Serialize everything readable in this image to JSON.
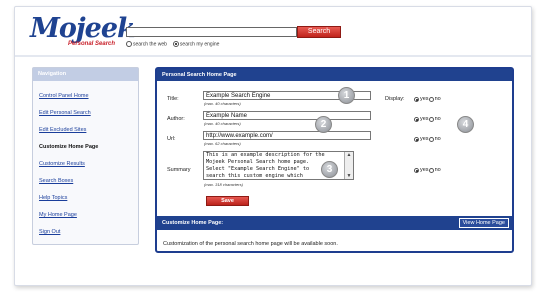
{
  "logo": {
    "text": "Mojeek",
    "subtitle": "Personal Search"
  },
  "search": {
    "value": "",
    "button_label": "Search",
    "scope_web": "search the web",
    "scope_engine": "search my engine"
  },
  "sidebar": {
    "title": "Navigation",
    "items": [
      {
        "label": "Control Panel Home"
      },
      {
        "label": "Edit Personal Search"
      },
      {
        "label": "Edit Excluded Sites"
      },
      {
        "label": "Customize Home Page"
      },
      {
        "label": "Customize Results"
      },
      {
        "label": "Search Boxes"
      },
      {
        "label": "Help Topics"
      },
      {
        "label": "My Home Page"
      },
      {
        "label": "Sign Out"
      }
    ]
  },
  "panel": {
    "title": "Personal Search Home Page",
    "title_field": {
      "label": "Title:",
      "value": "Example Search Engine",
      "hint": "(max. 40 characters)"
    },
    "author_field": {
      "label": "Author:",
      "value": "Example Name",
      "hint": "(max. 40 characters)"
    },
    "url_field": {
      "label": "Url:",
      "value": "http://www.example.com/",
      "hint": "(max. 62 characters)"
    },
    "summary_field": {
      "label": "Summary",
      "value": "This is an example description for the\nMojeek Personal Search home page.\nSelect \"Example Search Engine\" to\nsearch this custom engine which",
      "hint": "(max. 318 characters)"
    },
    "display_label": "Display:",
    "yes_label": "yes",
    "no_label": "no",
    "save_label": "Save",
    "badges": [
      "1",
      "2",
      "3",
      "4"
    ]
  },
  "customize": {
    "title": "Customize Home Page:",
    "view_button": "View Home Page",
    "message": "Customization of the personal search home page will be available soon."
  }
}
